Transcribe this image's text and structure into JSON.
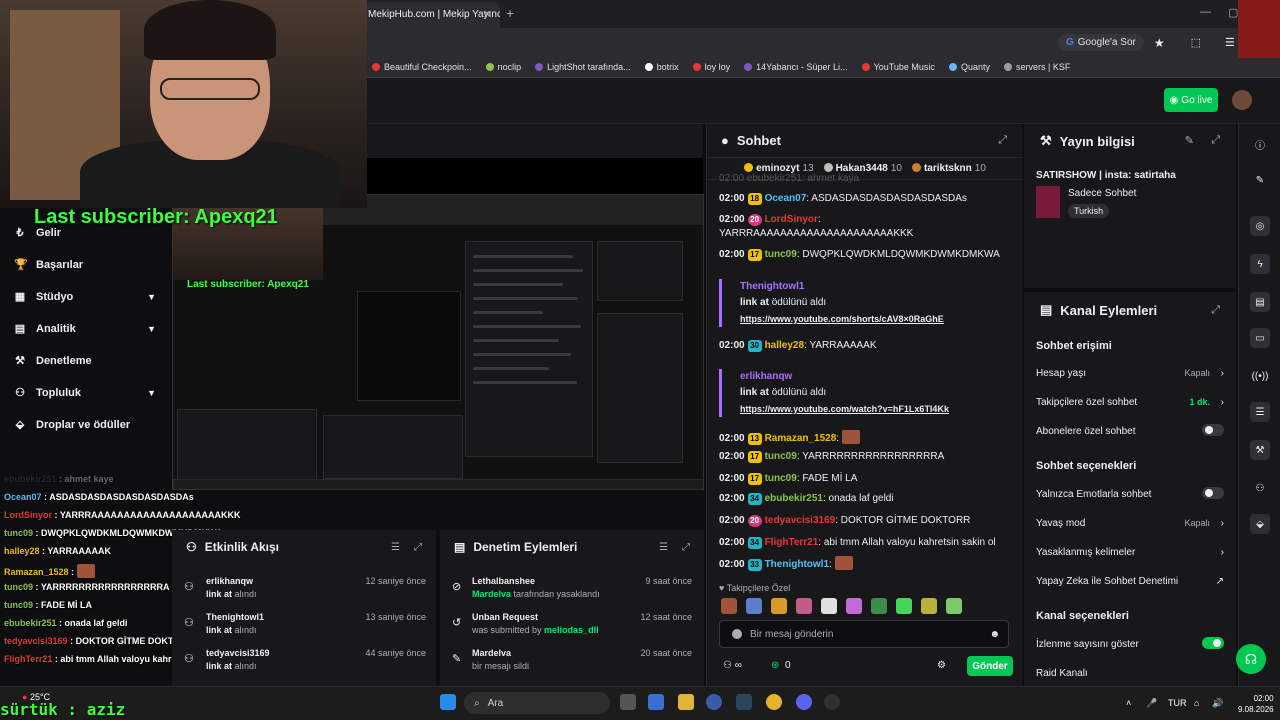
{
  "browser": {
    "tab_title": "MekipHub.com | Mekip Yayıncı",
    "google_pill": "Google'a Sor",
    "bookmarks": [
      {
        "label": "Beautiful Checkpoin...",
        "color": "#e53935"
      },
      {
        "label": "noclip",
        "color": "#8bc34a"
      },
      {
        "label": "LightShot tarafında...",
        "color": "#7e57c2"
      },
      {
        "label": "botrix",
        "color": "#ffffff"
      },
      {
        "label": "loy loy",
        "color": "#e53935"
      },
      {
        "label": "14Yabancı - Süper Li...",
        "color": "#7e57c2"
      },
      {
        "label": "YouTube Music",
        "color": "#e53935"
      },
      {
        "label": "Quanty",
        "color": "#64b5f6"
      },
      {
        "label": "servers | KSF",
        "color": "#9e9e9e"
      }
    ]
  },
  "topnav": {
    "go_live": "Go live"
  },
  "overlay": {
    "last_subscriber": "Last subscriber: Apexq21",
    "viewer_name": "sürtük : aziz",
    "chat": [
      {
        "user": "ebubekir251",
        "text": "ahmet kaye",
        "color": "#555555"
      },
      {
        "user": "Ocean07",
        "text": "ASDASDASDASDASDASDASDAs",
        "color": "#4fc3f7"
      },
      {
        "user": "LordSinyor",
        "text": "YARRRAAAAAAAAAAAAAAAAAAAAKKK",
        "color": "#e53935"
      },
      {
        "user": "tunc09",
        "text": "DWQPKLQWDKMLDQWMKDWMKDMKWA",
        "color": "#8bc34a"
      },
      {
        "user": "halley28",
        "text": "YARRAAAAAK",
        "color": "#f0c000"
      },
      {
        "user": "Ramazan_1528",
        "text": "",
        "color": "#f0c000"
      },
      {
        "user": "tunc09",
        "text": "YARRRRRRRRRRRRRRRRRA",
        "color": "#8bc34a"
      },
      {
        "user": "tunc09",
        "text": "FADE Mİ LA",
        "color": "#8bc34a"
      },
      {
        "user": "ebubekir251",
        "text": "onada laf geldi",
        "color": "#8bc34a"
      },
      {
        "user": "tedyavcisi3169",
        "text": "DOKTOR GİTME DOKTORR",
        "color": "#e53935"
      },
      {
        "user": "FlighTerr21",
        "text": "abi tmm Allah valoyu kahretsin sakin ol",
        "color": "#e53935"
      }
    ]
  },
  "leftnav": {
    "items": [
      {
        "label": "Gelir",
        "icon": "₺",
        "chevron": false
      },
      {
        "label": "Başarılar",
        "icon": "🏆",
        "chevron": false
      },
      {
        "label": "Stüdyo",
        "icon": "▦",
        "chevron": true
      },
      {
        "label": "Analitik",
        "icon": "▤",
        "chevron": true
      },
      {
        "label": "Denetleme",
        "icon": "⚒",
        "chevron": false
      },
      {
        "label": "Topluluk",
        "icon": "⚇",
        "chevron": true
      },
      {
        "label": "Droplar ve ödüller",
        "icon": "⬙",
        "chevron": false
      }
    ]
  },
  "activity": {
    "title": "Etkinlik Akışı",
    "items": [
      {
        "name": "erlikhanqw",
        "action_link": "link at",
        "action": "alındı",
        "time": "12 saniye önce"
      },
      {
        "name": "Thenightowl1",
        "action_link": "link at",
        "action": "alındı",
        "time": "13 saniye önce"
      },
      {
        "name": "tedyavcisi3169",
        "action_link": "link at",
        "action": "alındı",
        "time": "44 saniye önce"
      }
    ]
  },
  "moderation": {
    "title": "Denetim Eylemleri",
    "items": [
      {
        "name": "Lethalbanshee",
        "detail_user": "Mardelva",
        "detail": "tarafından yasaklandı",
        "time": "9 saat önce"
      },
      {
        "name": "Unban Request",
        "detail": "was submitted by",
        "detail_user": "meliodas_dll",
        "time": "12 saat önce"
      },
      {
        "name": "Mardelva",
        "detail": "bir mesajı sildi",
        "detail_user": "",
        "time": "20 saat önce"
      }
    ]
  },
  "chat": {
    "title": "Sohbet",
    "leaders": [
      {
        "name": "eminozyt",
        "count": "13",
        "color": "#f0c000"
      },
      {
        "name": "Hakan3448",
        "count": "10",
        "color": "#bdbdbd"
      },
      {
        "name": "tariktsknn",
        "count": "10",
        "color": "#cd7f32"
      }
    ],
    "partial_line": "02:00 ebubekir251: ahmet kaya",
    "messages": [
      {
        "time": "02:00",
        "badge": "18",
        "badge_type": "yellow",
        "user": "Ocean07",
        "color": "#4fc3f7",
        "text": "ASDASDASDASDASDASDASDAs"
      },
      {
        "time": "02:00",
        "badge": "20",
        "badge_type": "pink",
        "user": "LordSinyor",
        "color": "#e53935",
        "text": "YARRRAAAAAAAAAAAAAAAAAAAAAKKK"
      },
      {
        "time": "02:00",
        "badge": "17",
        "badge_type": "yellow",
        "user": "tunc09",
        "color": "#8bc34a",
        "text": "DWQPKLQWDKMLDQWMKDWMKDMKWA"
      },
      {
        "time": "02:00",
        "badge": "30",
        "badge_type": "teal",
        "user": "halley28",
        "color": "#f0c000",
        "text": "YARRAAAAAK"
      },
      {
        "time": "02:00",
        "badge": "13",
        "badge_type": "yellow",
        "user": "Ramazan_1528",
        "color": "#f0c000",
        "text": ""
      },
      {
        "time": "02:00",
        "badge": "17",
        "badge_type": "yellow",
        "user": "tunc09",
        "color": "#8bc34a",
        "text": "YARRRRRRRRRRRRRRRRRA"
      },
      {
        "time": "02:00",
        "badge": "17",
        "badge_type": "yellow",
        "user": "tunc09",
        "color": "#8bc34a",
        "text": "FADE Mİ LA"
      },
      {
        "time": "02:00",
        "badge": "34",
        "badge_type": "teal",
        "user": "ebubekir251",
        "color": "#8bc34a",
        "text": "onada laf geldi"
      },
      {
        "time": "02:00",
        "badge": "20",
        "badge_type": "pink",
        "user": "tedyavcisi3169",
        "color": "#e53935",
        "text": "DOKTOR GİTME DOKTORR"
      },
      {
        "time": "02:00",
        "badge": "34",
        "badge_type": "teal",
        "user": "FlighTerr21",
        "color": "#e53935",
        "text": "abi tmm Allah valoyu kahretsin sakin ol"
      },
      {
        "time": "02:00",
        "badge": "33",
        "badge_type": "teal",
        "user": "Thenightowl1",
        "color": "#4fc3f7",
        "text": ""
      }
    ],
    "redeems": [
      {
        "user": "Thenightowl1",
        "title": "link at",
        "suffix": "ödülünü aldı",
        "link": "https://www.youtube.com/shorts/cAV8×0RaGhE"
      },
      {
        "user": "erlikhanqw",
        "title": "link at",
        "suffix": "ödülünü aldı",
        "link": "https://www.youtube.com/watch?v=hF1Lx6TI4Kk"
      }
    ],
    "followers_only": "Takipçilere Özel",
    "input_placeholder": "Bir mesaj gönderin",
    "points": "0",
    "send_label": "Gönder"
  },
  "stream_info": {
    "title": "Yayın bilgisi",
    "stream_title": "SATIRSHOW | insta: satirtaha",
    "category": "Sadece Sohbet",
    "tag": "Turkish"
  },
  "channel_actions": {
    "title": "Kanal Eylemleri",
    "chat_access_header": "Sohbet erişimi",
    "rows_access": [
      {
        "label": "Hesap yaşı",
        "value": "Kapalı",
        "type": "arrow"
      },
      {
        "label": "Takipçilere özel sohbet",
        "value": "1 dk.",
        "type": "arrow-green"
      },
      {
        "label": "Abonelere özel sohbet",
        "value": "",
        "type": "toggle-off"
      }
    ],
    "chat_options_header": "Sohbet seçenekleri",
    "rows_options": [
      {
        "label": "Yalnızca Emotlarla sohbet",
        "value": "",
        "type": "toggle-off"
      },
      {
        "label": "Yavaş mod",
        "value": "Kapalı",
        "type": "arrow"
      },
      {
        "label": "Yasaklanmış kelimeler",
        "value": "",
        "type": "arrow"
      },
      {
        "label": "Yapay Zeka ile Sohbet Denetimi",
        "value": "",
        "type": "external"
      }
    ],
    "channel_options_header": "Kanal seçenekleri",
    "rows_channel": [
      {
        "label": "İzlenme sayısını göster",
        "value": "",
        "type": "toggle-on"
      },
      {
        "label": "Raid Kanalı",
        "value": "",
        "type": "none"
      }
    ]
  },
  "taskbar": {
    "weather": "25°C",
    "search": "Ara",
    "lang": "TUR",
    "time": "02:00",
    "date": "9.08.2026"
  }
}
